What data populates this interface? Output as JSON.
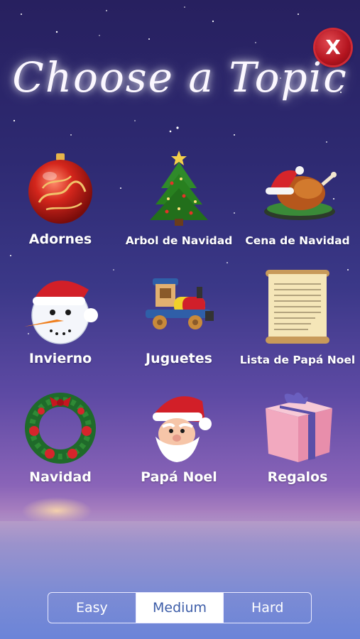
{
  "header": {
    "title": "Choose a Topic",
    "close_label": "X"
  },
  "topics": [
    {
      "label": "Adornes",
      "icon": "ornament-ball-icon"
    },
    {
      "label": "Arbol de Navidad",
      "icon": "christmas-tree-icon"
    },
    {
      "label": "Cena de Navidad",
      "icon": "roast-turkey-icon"
    },
    {
      "label": "Invierno",
      "icon": "snowman-icon"
    },
    {
      "label": "Juguetes",
      "icon": "toy-train-icon"
    },
    {
      "label": "Lista de Papá Noel",
      "icon": "scroll-list-icon"
    },
    {
      "label": "Navidad",
      "icon": "wreath-icon"
    },
    {
      "label": "Papá Noel",
      "icon": "santa-face-icon"
    },
    {
      "label": "Regalos",
      "icon": "gift-box-icon"
    }
  ],
  "difficulty": {
    "options": [
      "Easy",
      "Medium",
      "Hard"
    ],
    "selected": "Medium"
  },
  "colors": {
    "sky_top": "#27205f",
    "close_red": "#b4141f",
    "selected_text": "#3d5da8"
  }
}
